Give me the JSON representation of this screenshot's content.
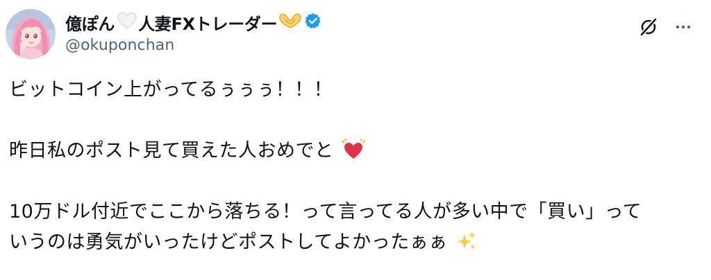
{
  "post": {
    "author": {
      "name_part1": "億ぽん",
      "name_emoji1": "white-heart",
      "name_part2": "人妻FXトレーダー",
      "name_emoji2": "heart-hands",
      "verified": true,
      "handle": "@okuponchan"
    },
    "actions": {
      "grok_icon": "grok-icon",
      "more_icon": "more-dots-icon"
    },
    "body": {
      "line1": "ビットコイン上がってるぅぅぅ！！！",
      "line2": "昨日私のポスト見て買えた人おめでと",
      "line2_emoji": "beating-heart",
      "line3": "10万ドル付近でここから落ちる！って言ってる人が多い中で「買い」って",
      "line4": "いうのは勇気がいったけどポストしてよかったぁぁ",
      "line4_emoji": "sparkles"
    },
    "colors": {
      "text": "#0f1419",
      "secondary": "#536471",
      "verified_blue": "#1d9bf0",
      "heart_red": "#e0334a",
      "sparkle_yellow": "#ffcc33"
    }
  }
}
